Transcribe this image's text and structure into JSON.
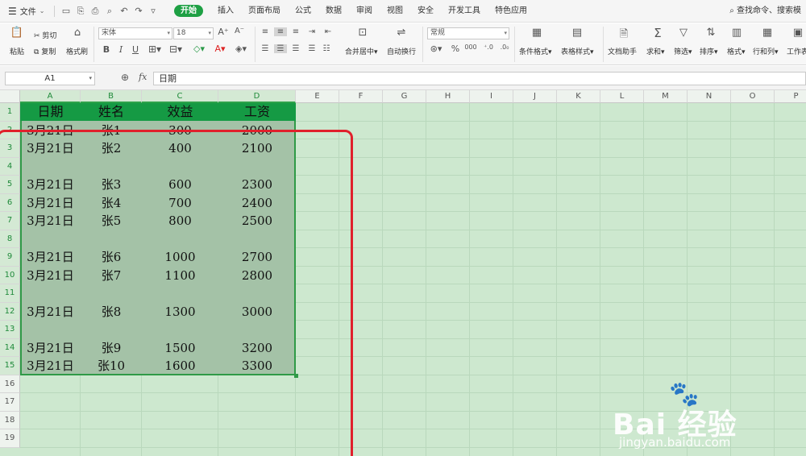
{
  "menubar": {
    "file_label": "文件",
    "tabs": [
      "开始",
      "插入",
      "页面布局",
      "公式",
      "数据",
      "审阅",
      "视图",
      "安全",
      "开发工具",
      "特色应用"
    ],
    "active_tab": "开始",
    "search_label": "查找命令、搜索模"
  },
  "ribbon": {
    "paste": "粘贴",
    "cut": "剪切",
    "copy": "复制",
    "format_painter": "格式刷",
    "font_name": "宋体",
    "font_size": "18",
    "merge_center": "合并居中",
    "wrap_text": "自动换行",
    "number_format": "常规",
    "conditional_format": "条件格式",
    "table_style": "表格样式",
    "doc_helper": "文档助手",
    "sum": "求和",
    "filter": "筛选",
    "sort": "排序",
    "format": "格式",
    "row_col": "行和列",
    "worksheet": "工作表"
  },
  "formula_bar": {
    "name_box": "A1",
    "formula": "日期"
  },
  "grid": {
    "columns": [
      "A",
      "B",
      "C",
      "D",
      "E",
      "F",
      "G",
      "H",
      "I",
      "J",
      "K",
      "L",
      "M",
      "N",
      "O",
      "P"
    ],
    "rows": [
      "1",
      "2",
      "3",
      "4",
      "5",
      "6",
      "7",
      "8",
      "9",
      "10",
      "11",
      "12",
      "13",
      "14",
      "15",
      "16",
      "17",
      "18",
      "19"
    ],
    "header": [
      "日期",
      "姓名",
      "效益",
      "工资"
    ],
    "data": [
      [
        "3月21日",
        "张1",
        "300",
        "2000"
      ],
      [
        "3月21日",
        "张2",
        "400",
        "2100"
      ],
      [
        "",
        "",
        "",
        ""
      ],
      [
        "3月21日",
        "张3",
        "600",
        "2300"
      ],
      [
        "3月21日",
        "张4",
        "700",
        "2400"
      ],
      [
        "3月21日",
        "张5",
        "800",
        "2500"
      ],
      [
        "",
        "",
        "",
        ""
      ],
      [
        "3月21日",
        "张6",
        "1000",
        "2700"
      ],
      [
        "3月21日",
        "张7",
        "1100",
        "2800"
      ],
      [
        "",
        "",
        "",
        ""
      ],
      [
        "3月21日",
        "张8",
        "1300",
        "3000"
      ],
      [
        "",
        "",
        "",
        ""
      ],
      [
        "3月21日",
        "张9",
        "1500",
        "3200"
      ],
      [
        "3月21日",
        "张10",
        "1600",
        "3300"
      ]
    ]
  },
  "watermark": {
    "brand": "Bai 经验",
    "url": "jingyan.baidu.com"
  },
  "colors": {
    "accent": "#1ea044",
    "header_fill": "#159a44",
    "selection": "#a4c2a7",
    "grid_bg": "#cde8cf",
    "annotation": "#e0202c"
  }
}
